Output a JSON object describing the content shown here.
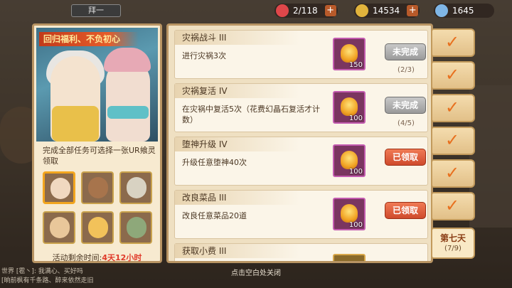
{
  "topbar": {
    "tab_label": "拜一",
    "stamina": "2/118",
    "coins": "14534",
    "gems": "1645",
    "plus": "+"
  },
  "event": {
    "banner_title": "回归福利、不负初心",
    "description": "完成全部任务可选择一张UR飨灵领取",
    "timer_label": "活动剩余时间:",
    "timer_value": "4天12小时"
  },
  "tasks": [
    {
      "title": "灾祸战斗 III",
      "desc": "进行灾祸3次",
      "qty": "150",
      "button": "未完成",
      "progress": "(2/3)",
      "state": "gray"
    },
    {
      "title": "灾祸复活 IV",
      "desc": "在灾祸中复活5次（花费幻晶石复活才计数）",
      "qty": "100",
      "button": "未完成",
      "progress": "(4/5)",
      "state": "gray"
    },
    {
      "title": "堕神升级 IV",
      "desc": "升级任意堕神40次",
      "qty": "100",
      "button": "已领取",
      "progress": "",
      "state": "red"
    },
    {
      "title": "改良菜品 III",
      "desc": "改良任意菜品20道",
      "qty": "100",
      "button": "已领取",
      "progress": "",
      "state": "red"
    }
  ],
  "partial_task": {
    "title": "获取小费 III"
  },
  "day_tabs": {
    "check": "✓",
    "active_label": "第七天",
    "active_progress": "(7/9)"
  },
  "footer": {
    "close_hint": "点击空白处关闭",
    "chat_line1": "世界 [雹丶]: 我满心、买好吗",
    "chat_line2": "[晌前枫有千条路、醉来依然走旧"
  },
  "colors": {
    "accent_red": "#cf4a2c",
    "check_orange": "#e8701e",
    "timer_red": "#e03a2a"
  }
}
